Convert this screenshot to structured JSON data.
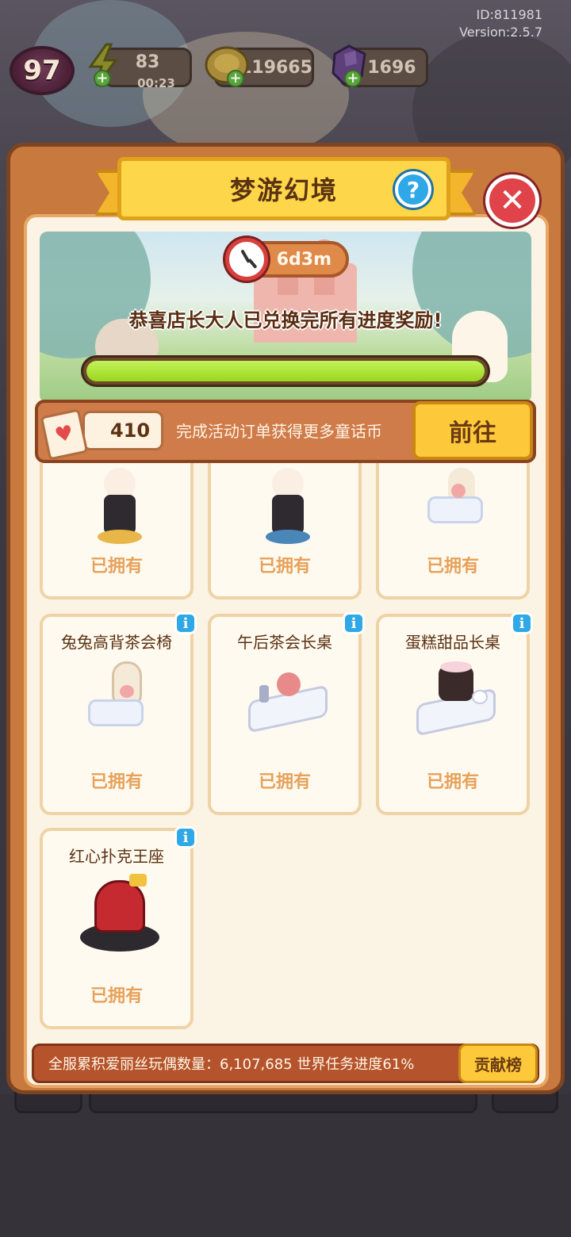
{
  "meta": {
    "id": "ID:811981",
    "version": "Version:2.5.7"
  },
  "hud": {
    "level": "97",
    "energy": {
      "value": "83",
      "timer": "00:23",
      "icon": "lightning-icon"
    },
    "coins": {
      "value": "119665",
      "icon": "gold-coin-icon"
    },
    "gems": {
      "value": "1696",
      "icon": "purple-gem-icon"
    }
  },
  "dialog": {
    "title": "梦游幻境",
    "help_label": "?",
    "close_label": "✕"
  },
  "banner": {
    "timer": "6d3m",
    "message": "恭喜店长大人已兑换完所有进度奖励!",
    "progress": 1.0
  },
  "currency": {
    "icon": "heart-card-icon",
    "count": "410",
    "task_text": "完成活动订单获得更多童话币",
    "go_label": "前往"
  },
  "items": [
    {
      "name": "",
      "status": "已拥有",
      "art": "rabbit-guard-red"
    },
    {
      "name": "",
      "status": "已拥有",
      "art": "rabbit-guard-blue"
    },
    {
      "name": "",
      "status": "已拥有",
      "art": "rabbit-heart-chair"
    },
    {
      "name": "兔兔高背茶会椅",
      "status": "已拥有",
      "art": "rabbit-tea-chair"
    },
    {
      "name": "午后茶会长桌",
      "status": "已拥有",
      "art": "tea-party-table"
    },
    {
      "name": "蛋糕甜品长桌",
      "status": "已拥有",
      "art": "cake-dessert-table"
    },
    {
      "name": "红心扑克王座",
      "status": "已拥有",
      "art": "red-heart-throne"
    }
  ],
  "footer": {
    "text": "全服累积爱丽丝玩偶数量：6,107,685  世界任务进度61%",
    "rank_label": "贡献榜"
  }
}
